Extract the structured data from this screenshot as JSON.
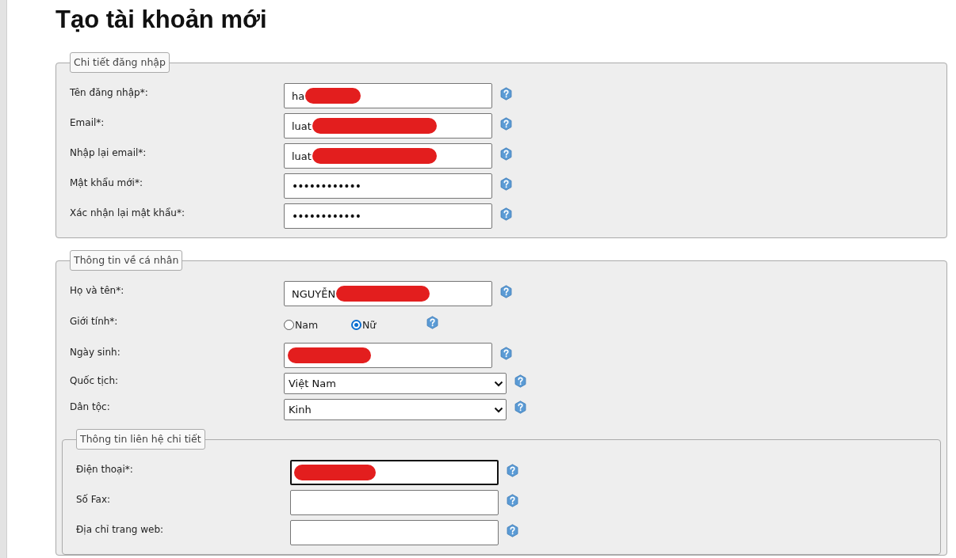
{
  "title": "Tạo tài khoản mới",
  "sections": [
    {
      "legend": "Chi tiết đăng nhập",
      "rows": [
        {
          "kind": "text",
          "label": "Tên đăng nhập*:",
          "value": "ha",
          "redacted": true
        },
        {
          "kind": "text",
          "label": "Email*:",
          "value": "luat",
          "redacted": true
        },
        {
          "kind": "text",
          "label": "Nhập lại email*:",
          "value": "luat",
          "redacted": true
        },
        {
          "kind": "text",
          "label": "Mật khẩu mới*:",
          "value": "••••••••••••"
        },
        {
          "kind": "text",
          "label": "Xác nhận lại mật khẩu*:",
          "value": "••••••••••••"
        }
      ]
    },
    {
      "legend": "Thông tin về cá nhân",
      "rows": [
        {
          "kind": "text",
          "label": "Họ và tên*:",
          "value": "NGUYỄN",
          "redacted": true
        },
        {
          "kind": "radio",
          "label": "Giới tính*:",
          "options": [
            {
              "label": "Nam",
              "selected": false
            },
            {
              "label": "Nữ",
              "selected": true
            }
          ]
        },
        {
          "kind": "text",
          "label": "Ngày sinh:",
          "redacted": true
        },
        {
          "kind": "select",
          "label": "Quốc tịch:",
          "value": "Việt Nam"
        },
        {
          "kind": "select",
          "label": "Dân tộc:",
          "value": "Kinh"
        }
      ],
      "subsections": [
        {
          "legend": "Thông tin liên hệ chi tiết",
          "rows": [
            {
              "kind": "text",
              "label": "Điện thoại*:",
              "redacted": true,
              "focused": true
            },
            {
              "kind": "text",
              "label": "Số Fax:",
              "focused": false
            },
            {
              "kind": "text",
              "label": "Địa chỉ trang web:",
              "focused": false
            }
          ]
        }
      ]
    }
  ]
}
